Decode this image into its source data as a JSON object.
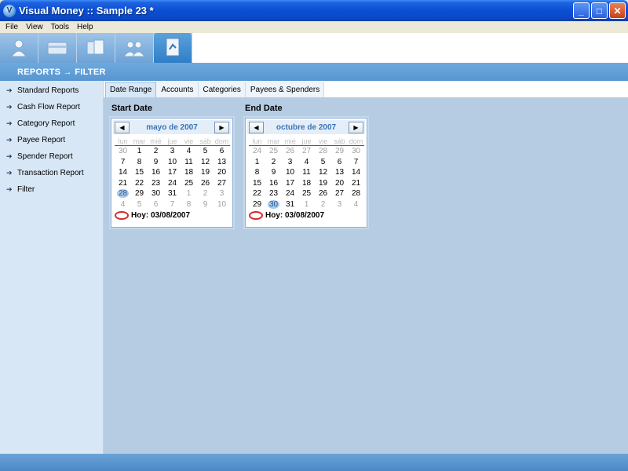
{
  "window": {
    "title": "Visual Money :: Sample 23 *",
    "buttons": [
      "_",
      "□",
      "✕"
    ]
  },
  "menu": [
    "File",
    "View",
    "Tools",
    "Help"
  ],
  "toolbar": [
    "people-icon",
    "cards-icon",
    "accounts-icon",
    "payees-icon",
    "reports-icon"
  ],
  "section": {
    "title": "REPORTS → FILTER"
  },
  "sidebar": {
    "items": [
      {
        "label": "Standard Reports"
      },
      {
        "label": "Cash Flow Report"
      },
      {
        "label": "Category Report"
      },
      {
        "label": "Payee Report"
      },
      {
        "label": "Spender Report"
      },
      {
        "label": "Transaction Report"
      },
      {
        "label": "Filter"
      }
    ]
  },
  "tabs": [
    {
      "label": "Date Range",
      "active": true
    },
    {
      "label": "Accounts"
    },
    {
      "label": "Categories"
    },
    {
      "label": "Payees & Spenders"
    }
  ],
  "start": {
    "label": "Start Date",
    "month": "mayo de 2007",
    "dows": [
      "lun",
      "mar",
      "mié",
      "jue",
      "vie",
      "sáb",
      "dom"
    ],
    "days": [
      "30",
      "1",
      "2",
      "3",
      "4",
      "5",
      "6",
      "7",
      "8",
      "9",
      "10",
      "11",
      "12",
      "13",
      "14",
      "15",
      "16",
      "17",
      "18",
      "19",
      "20",
      "21",
      "22",
      "23",
      "24",
      "25",
      "26",
      "27",
      "28",
      "29",
      "30",
      "31",
      "1",
      "2",
      "3",
      "4",
      "5",
      "6",
      "7",
      "8",
      "9",
      "10"
    ],
    "other_prefix": 1,
    "other_suffix_from": 32,
    "selected_index": 28,
    "today": "Hoy: 03/08/2007"
  },
  "end": {
    "label": "End Date",
    "month": "octubre de 2007",
    "dows": [
      "lun",
      "mar",
      "mié",
      "jue",
      "vie",
      "sáb",
      "dom"
    ],
    "days": [
      "24",
      "25",
      "26",
      "27",
      "28",
      "29",
      "30",
      "1",
      "2",
      "3",
      "4",
      "5",
      "6",
      "7",
      "8",
      "9",
      "10",
      "11",
      "12",
      "13",
      "14",
      "15",
      "16",
      "17",
      "18",
      "19",
      "20",
      "21",
      "22",
      "23",
      "24",
      "25",
      "26",
      "27",
      "28",
      "29",
      "30",
      "31",
      "1",
      "2",
      "3",
      "4"
    ],
    "other_prefix": 7,
    "other_suffix_from": 38,
    "selected_index": 36,
    "today": "Hoy: 03/08/2007"
  },
  "colors": {
    "accent": "#3a72b4",
    "panel": "#b5cce3",
    "sidebar": "#d7e7f6"
  }
}
